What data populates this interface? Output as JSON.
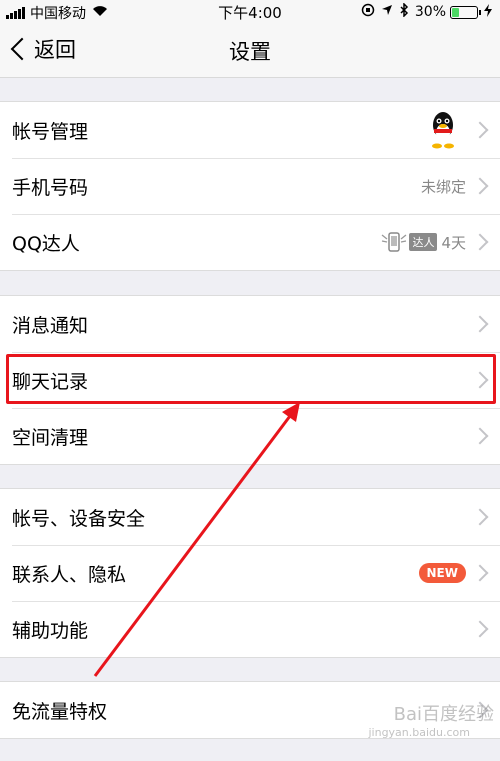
{
  "status_bar": {
    "carrier": "中国移动",
    "time": "下午4:00",
    "battery": "30%",
    "battery_level": 0.3
  },
  "nav": {
    "back_label": "返回",
    "title": "设置"
  },
  "group1": {
    "account": {
      "label": "帐号管理"
    },
    "phone": {
      "label": "手机号码",
      "value": "未绑定"
    },
    "qq_daren": {
      "label": "QQ达人",
      "tag": "达人",
      "value": "4天"
    }
  },
  "group2": {
    "notifications": {
      "label": "消息通知"
    },
    "chat_history": {
      "label": "聊天记录"
    },
    "storage": {
      "label": "空间清理"
    }
  },
  "group3": {
    "security": {
      "label": "帐号、设备安全"
    },
    "privacy": {
      "label": "联系人、隐私",
      "badge": "NEW"
    },
    "accessibility": {
      "label": "辅助功能"
    }
  },
  "group4": {
    "data_free": {
      "label": "免流量特权"
    }
  },
  "watermark": {
    "text": "Bai百度经验",
    "sub": "jingyan.baidu.com"
  },
  "colors": {
    "highlight": "#e8151c",
    "badge": "#f35a3a",
    "battery": "#4cd964"
  }
}
